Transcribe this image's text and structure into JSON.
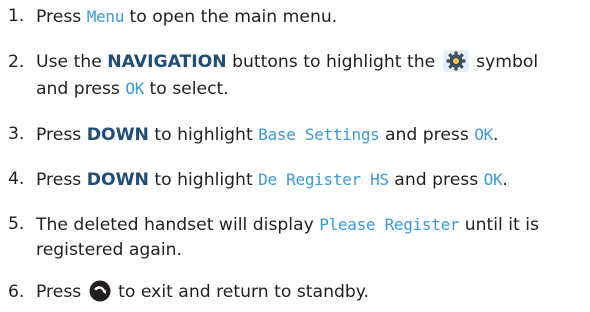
{
  "steps": [
    {
      "num": "1.",
      "a": "Press ",
      "d1": "Menu",
      "b": " to open the main menu."
    },
    {
      "num": "2.",
      "a": "Use the ",
      "k1": "NAVIGATION",
      "b": " buttons to highlight the ",
      "icon": "settings-gear-icon",
      "c": " symbol",
      "a2": "and press ",
      "d1": "OK",
      "b2": " to select."
    },
    {
      "num": "3.",
      "a": "Press ",
      "k1": "DOWN",
      "b": " to highlight ",
      "d1": "Base Settings",
      "c": " and press ",
      "d2": "OK",
      "e": "."
    },
    {
      "num": "4.",
      "a": "Press ",
      "k1": "DOWN",
      "b": " to highlight ",
      "d1": "De Register HS",
      "c": " and press ",
      "d2": "OK",
      "e": "."
    },
    {
      "num": "5.",
      "a": "The deleted handset will display ",
      "d1": "Please Register",
      "b": " until it is",
      "a2": "registered again."
    },
    {
      "num": "6.",
      "a": "Press ",
      "icon": "end-call-icon",
      "b": " to exit and return to standby."
    }
  ],
  "colors": {
    "text": "#231f20",
    "display_text": "#3a9ad9",
    "key_text": "#1f4e79"
  }
}
